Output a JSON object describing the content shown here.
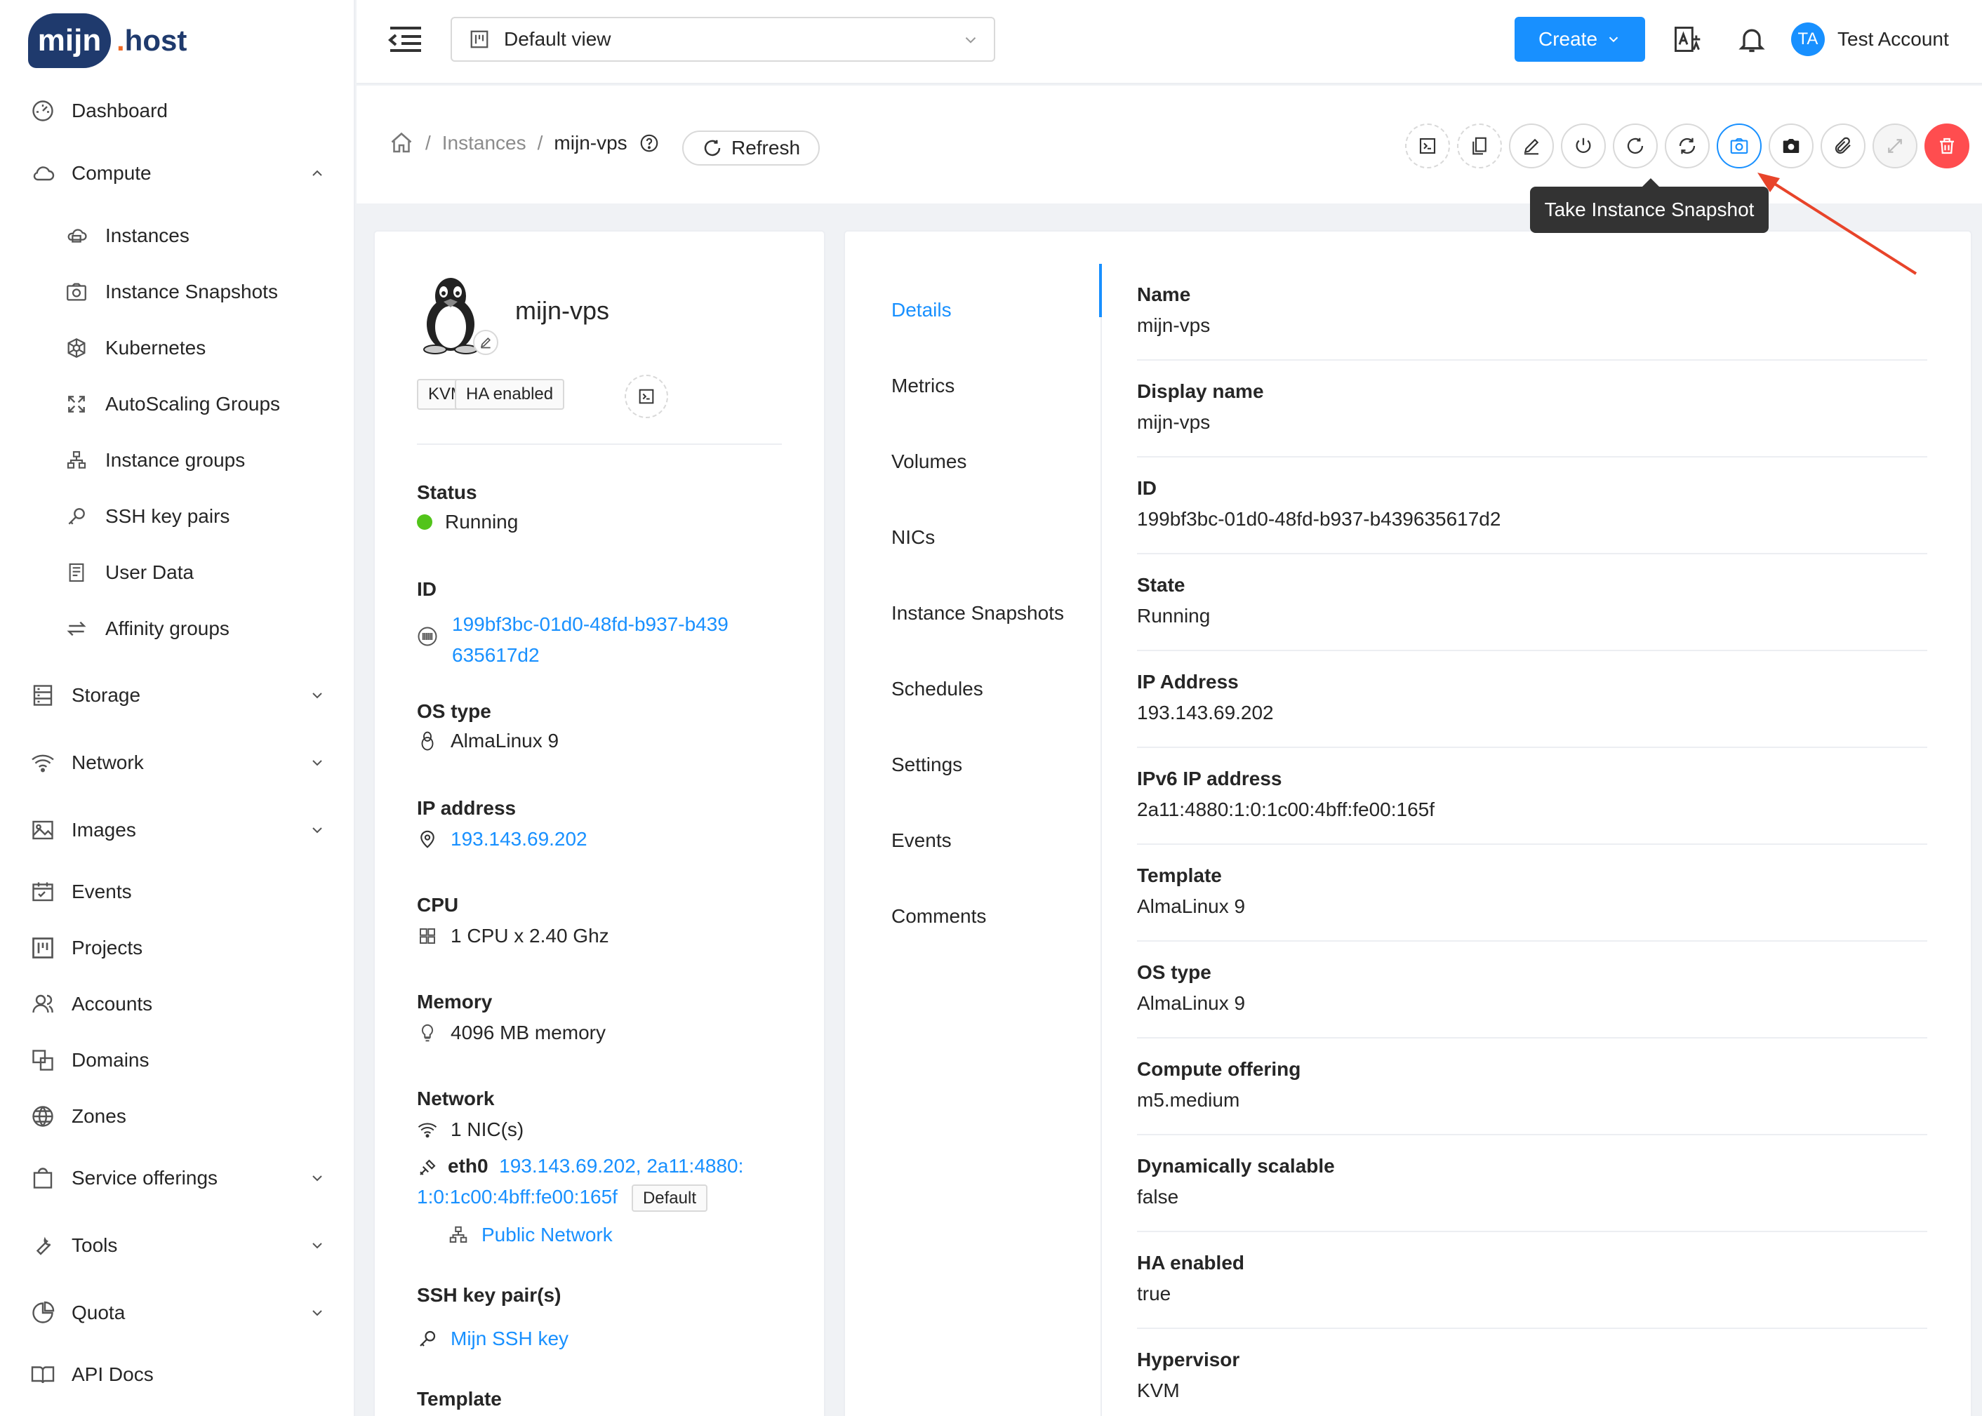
{
  "brand": {
    "bubble": "mijn",
    "dot": ".",
    "host": "host"
  },
  "sidebar": {
    "items": [
      {
        "label": "Dashboard",
        "icon": "dashboard-icon"
      },
      {
        "label": "Compute",
        "icon": "cloud-icon",
        "expanded": true
      },
      {
        "label": "Instances",
        "icon": "instances-icon"
      },
      {
        "label": "Instance Snapshots",
        "icon": "camera-icon"
      },
      {
        "label": "Kubernetes",
        "icon": "kubernetes-icon"
      },
      {
        "label": "AutoScaling Groups",
        "icon": "expand-icon"
      },
      {
        "label": "Instance groups",
        "icon": "cluster-icon"
      },
      {
        "label": "SSH key pairs",
        "icon": "key-icon"
      },
      {
        "label": "User Data",
        "icon": "file-icon"
      },
      {
        "label": "Affinity groups",
        "icon": "swap-icon"
      },
      {
        "label": "Storage",
        "icon": "database-icon"
      },
      {
        "label": "Network",
        "icon": "wifi-icon"
      },
      {
        "label": "Images",
        "icon": "picture-icon"
      },
      {
        "label": "Events",
        "icon": "schedule-icon"
      },
      {
        "label": "Projects",
        "icon": "project-icon"
      },
      {
        "label": "Accounts",
        "icon": "team-icon"
      },
      {
        "label": "Domains",
        "icon": "block-icon"
      },
      {
        "label": "Zones",
        "icon": "globe-icon"
      },
      {
        "label": "Service offerings",
        "icon": "shopping-icon"
      },
      {
        "label": "Tools",
        "icon": "tool-icon"
      },
      {
        "label": "Quota",
        "icon": "pie-chart-icon"
      },
      {
        "label": "API Docs",
        "icon": "book-icon"
      }
    ]
  },
  "header": {
    "view_select": "Default view",
    "create_label": "Create",
    "avatar_initials": "TA",
    "account_name": "Test Account"
  },
  "breadcrumb": {
    "instances": "Instances",
    "sep": "/",
    "current": "mijn-vps"
  },
  "toolbar": {
    "refresh_label": "Refresh",
    "tooltip": "Take Instance Snapshot",
    "actions": [
      "console-icon",
      "copy-icon",
      "edit-icon",
      "power-icon",
      "reboot-icon",
      "reinstall-icon",
      "snapshot-icon",
      "backup-icon",
      "attach-icon",
      "scale-icon",
      "delete-icon"
    ]
  },
  "instance": {
    "name": "mijn-vps",
    "tags": [
      "KVM",
      "HA enabled"
    ],
    "status_label": "Status",
    "status": "Running",
    "id_label": "ID",
    "id_line1": "199bf3bc-01d0-48fd-b937-b439",
    "id_line2": "635617d2",
    "os_label": "OS type",
    "os": "AlmaLinux 9",
    "ip_label": "IP address",
    "ip": "193.143.69.202",
    "cpu_label": "CPU",
    "cpu": "1 CPU x 2.40 Ghz",
    "memory_label": "Memory",
    "memory": "4096 MB memory",
    "network_label": "Network",
    "nics": "1 NIC(s)",
    "nic_name": "eth0",
    "nic_addr_line1": "193.143.69.202, 2a11:4880:",
    "nic_addr_line2": "1:0:1c00:4bff:fe00:165f",
    "nic_default": "Default",
    "network_name": "Public Network",
    "ssh_label": "SSH key pair(s)",
    "ssh": "Mijn SSH key",
    "template_label": "Template"
  },
  "tabs": [
    "Details",
    "Metrics",
    "Volumes",
    "NICs",
    "Instance Snapshots",
    "Schedules",
    "Settings",
    "Events",
    "Comments"
  ],
  "details": [
    {
      "label": "Name",
      "value": "mijn-vps"
    },
    {
      "label": "Display name",
      "value": "mijn-vps"
    },
    {
      "label": "ID",
      "value": "199bf3bc-01d0-48fd-b937-b439635617d2"
    },
    {
      "label": "State",
      "value": "Running"
    },
    {
      "label": "IP Address",
      "value": "193.143.69.202"
    },
    {
      "label": "IPv6 IP address",
      "value": "2a11:4880:1:0:1c00:4bff:fe00:165f"
    },
    {
      "label": "Template",
      "value": "AlmaLinux 9"
    },
    {
      "label": "OS type",
      "value": "AlmaLinux 9"
    },
    {
      "label": "Compute offering",
      "value": "m5.medium"
    },
    {
      "label": "Dynamically scalable",
      "value": "false"
    },
    {
      "label": "HA enabled",
      "value": "true"
    },
    {
      "label": "Hypervisor",
      "value": "KVM"
    }
  ],
  "colors": {
    "accent": "#1890ff",
    "danger": "#ff4d4f",
    "running": "#52c41a",
    "brand": "#1f3a6d",
    "brand_dot": "#f06a25",
    "annotation": "#e8442a"
  }
}
